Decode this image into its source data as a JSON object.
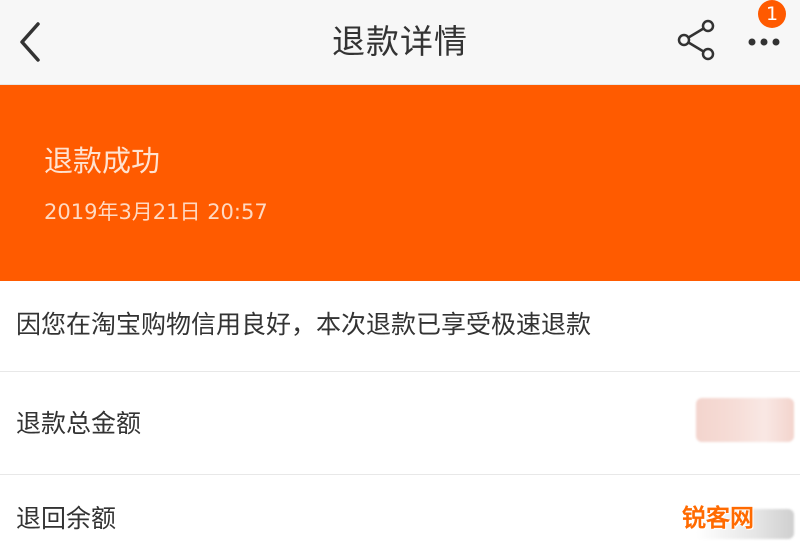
{
  "header": {
    "title": "退款详情",
    "badge_count": "1",
    "icons": {
      "back": "chevron-left-icon",
      "share": "share-icon",
      "more": "more-dots-icon"
    }
  },
  "status": {
    "title": "退款成功",
    "time": "2019年3月21日  20:57",
    "banner_color": "#ff5b00"
  },
  "notice": {
    "text": "因您在淘宝购物信用良好，本次退款已享受极速退款"
  },
  "rows": [
    {
      "label": "退款总金额"
    },
    {
      "label": "退回余额"
    }
  ],
  "watermark": "锐客网",
  "colors": {
    "accent": "#ff5b00",
    "text": "#333333",
    "divider": "#e8e8e8"
  }
}
